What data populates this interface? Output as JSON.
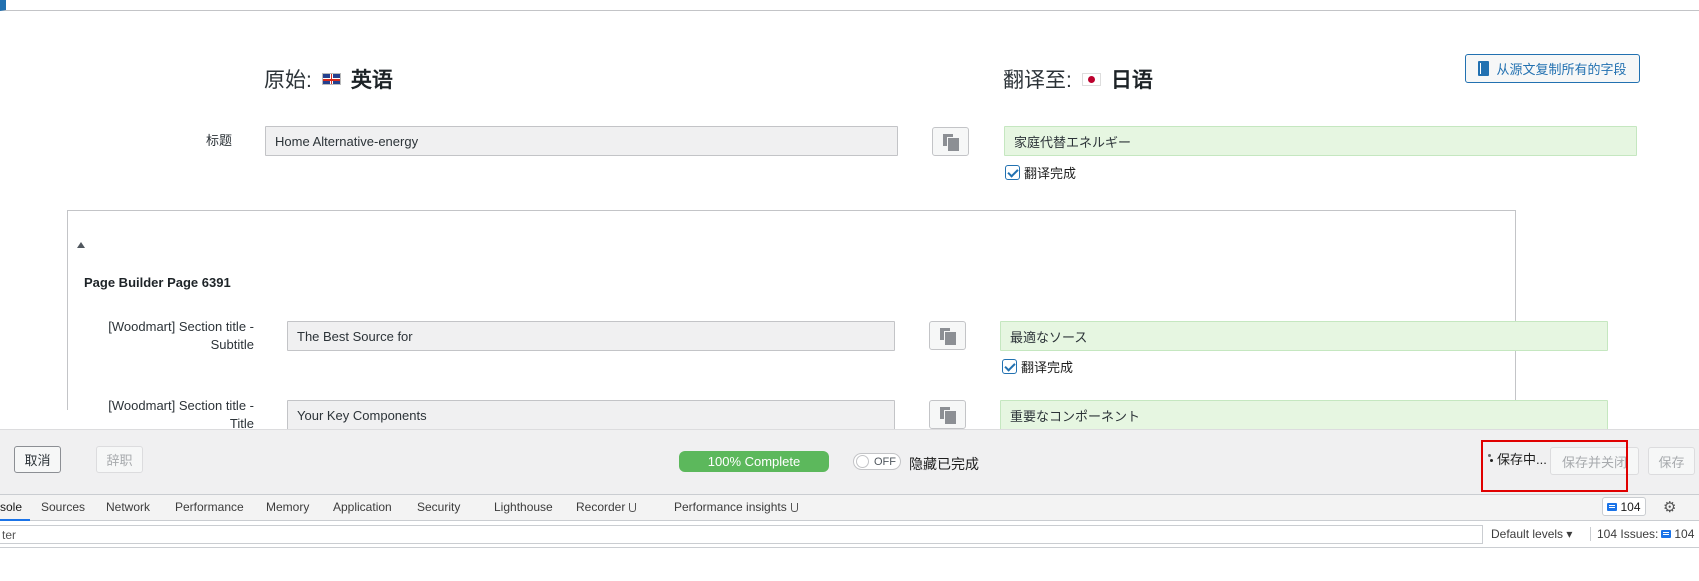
{
  "header": {
    "source_prefix": "原始:",
    "source_lang": "英语",
    "target_prefix": "翻译至:",
    "target_lang": "日语",
    "copy_all_label": "从源文复制所有的字段"
  },
  "title_field": {
    "label": "标题",
    "source_value": "Home Alternative-energy",
    "target_value": "家庭代替エネルギー",
    "done_label": "翻译完成"
  },
  "section": {
    "title": "Page Builder Page 6391",
    "fields": [
      {
        "label_line1": "[Woodmart] Section title -",
        "label_line2": "Subtitle",
        "source_value": "The Best Source for",
        "target_value": "最適なソース",
        "done_label": "翻译完成"
      },
      {
        "label_line1": "[Woodmart] Section title -",
        "label_line2": "Title",
        "source_value": "Your Key Components",
        "target_value": "重要なコンポーネント"
      }
    ]
  },
  "action_bar": {
    "cancel_label": "取消",
    "resign_label": "辞职",
    "progress_label": "100% Complete",
    "progress_value": 100,
    "toggle_label": "OFF",
    "hide_completed_label": "隐藏已完成",
    "saving_label": "保存中...",
    "save_close_label": "保存并关闭",
    "save_label": "保存"
  },
  "devtools": {
    "tabs": [
      "sole",
      "Sources",
      "Network",
      "Performance",
      "Memory",
      "Application",
      "Security",
      "Lighthouse",
      "Recorder",
      "Performance insights"
    ],
    "issues_badge": "104",
    "filter_placeholder": "ter",
    "levels_label": "Default levels ▾",
    "issues_label": "104 Issues:",
    "issues_count": "104"
  },
  "colors": {
    "accent": "#2271b1",
    "progress": "#5cb85c",
    "target_field_bg": "#e6f6e1",
    "highlight": "#e00000"
  }
}
